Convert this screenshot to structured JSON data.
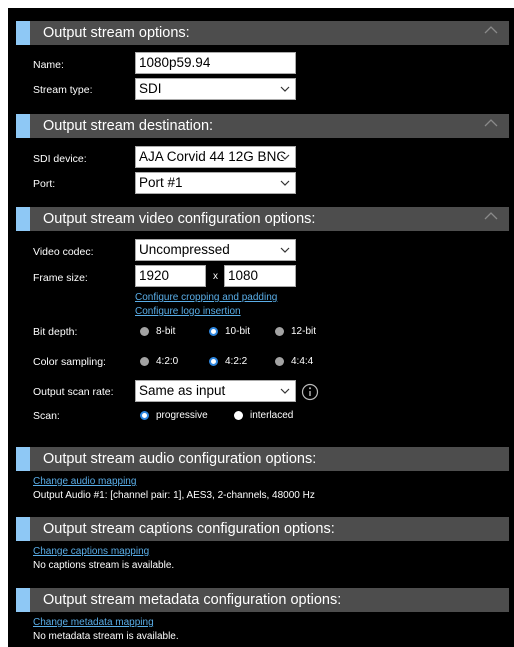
{
  "sections": {
    "options": {
      "title": "Output stream options:"
    },
    "destination": {
      "title": "Output stream destination:"
    },
    "video": {
      "title": "Output stream video configuration options:"
    },
    "audio": {
      "title": "Output stream audio configuration options:"
    },
    "captions": {
      "title": "Output stream captions configuration options:"
    },
    "metadata": {
      "title": "Output stream metadata configuration options:"
    }
  },
  "options": {
    "name_label": "Name:",
    "name_value": "1080p59.94",
    "stream_type_label": "Stream type:",
    "stream_type_value": "SDI"
  },
  "destination": {
    "device_label": "SDI device:",
    "device_value": "AJA Corvid 44 12G BNC",
    "port_label": "Port:",
    "port_value": "Port #1"
  },
  "video": {
    "codec_label": "Video codec:",
    "codec_value": "Uncompressed",
    "frame_size_label": "Frame size:",
    "width_value": "1920",
    "size_separator": "x",
    "height_value": "1080",
    "cropping_link": "Configure cropping and padding",
    "logo_link": "Configure logo insertion",
    "bit_depth_label": "Bit depth:",
    "bit_depth_options": [
      "8-bit",
      "10-bit",
      "12-bit"
    ],
    "bit_depth_selected": "10-bit",
    "color_label": "Color sampling:",
    "color_options": [
      "4:2:0",
      "4:2:2",
      "4:4:4"
    ],
    "color_selected": "4:2:2",
    "scan_rate_label": "Output scan rate:",
    "scan_rate_value": "Same as input",
    "scan_label": "Scan:",
    "scan_options": [
      "progressive",
      "interlaced"
    ],
    "scan_selected": "progressive"
  },
  "audio": {
    "mapping_link": "Change audio mapping",
    "info_text": "Output Audio #1: [channel pair: 1], AES3, 2-channels, 48000 Hz"
  },
  "captions": {
    "mapping_link": "Change captions mapping",
    "info_text": "No captions stream is available."
  },
  "metadata": {
    "mapping_link": "Change metadata mapping",
    "info_text": "No metadata stream is available."
  },
  "colors": {
    "background": "#000000",
    "header_bg": "#4d4d4d",
    "accent": "#8ec8f5",
    "link": "#5aaee8",
    "radio_selected": "#2e86de"
  }
}
